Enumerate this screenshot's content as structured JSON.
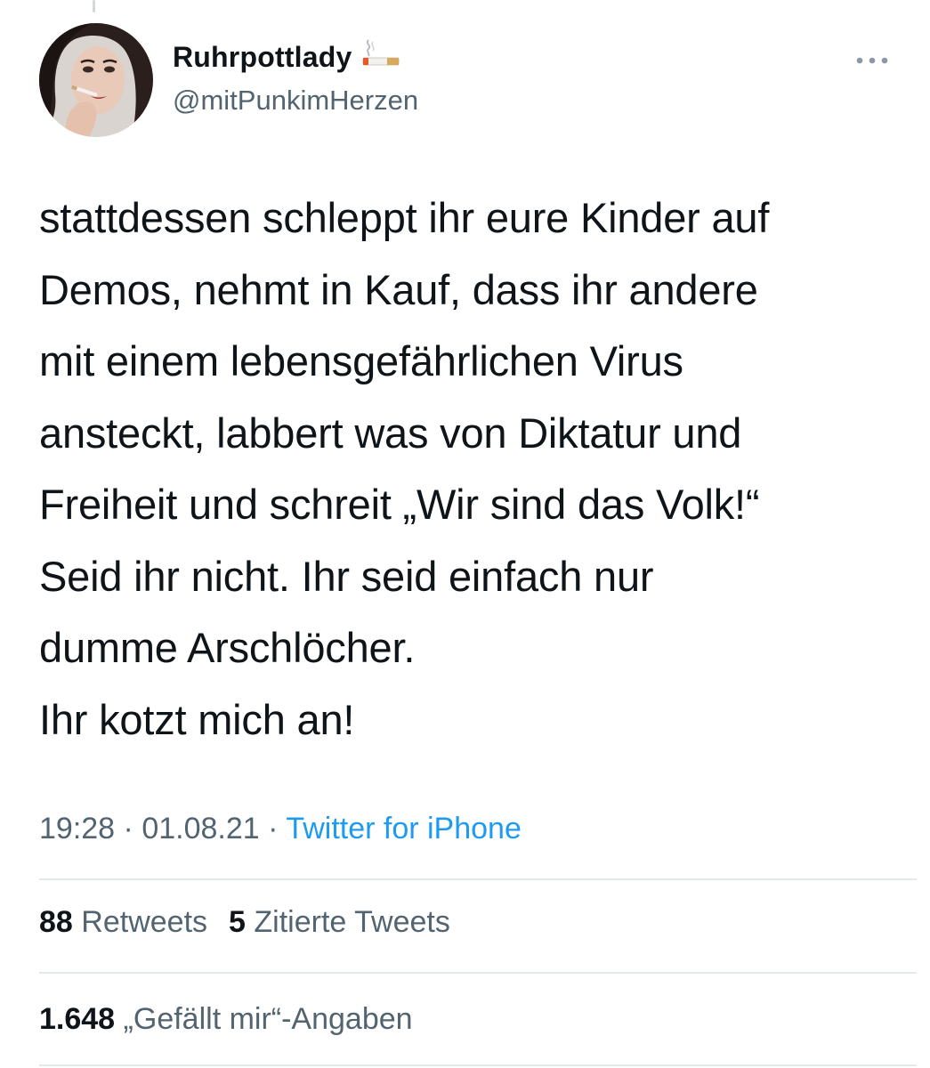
{
  "author": {
    "display_name": "Ruhrpottlady",
    "handle": "@mitPunkimHerzen",
    "name_emoji": "cigarette-icon"
  },
  "tweet": {
    "lines": [
      "stattdessen schleppt ihr eure Kinder auf",
      "Demos, nehmt in Kauf, dass ihr andere",
      "mit einem lebensgefährlichen Virus",
      "ansteckt, labbert was von Diktatur und",
      "Freiheit und schreit „Wir sind das Volk!“",
      "Seid ihr nicht. Ihr seid einfach nur",
      "dumme Arschlöcher.",
      "Ihr kotzt mich an!"
    ],
    "time": "19:28",
    "separator": "·",
    "date": "01.08.21",
    "source": "Twitter for iPhone"
  },
  "stats": {
    "retweets_count": "88",
    "retweets_label": "Retweets",
    "quotes_count": "5",
    "quotes_label": "Zitierte Tweets",
    "likes_count": "1.648",
    "likes_label": "„Gefällt mir“-Angaben"
  },
  "colors": {
    "text": "#0f1419",
    "secondary": "#536471",
    "link": "#1d9bf0",
    "divider": "#e6e9ec"
  }
}
